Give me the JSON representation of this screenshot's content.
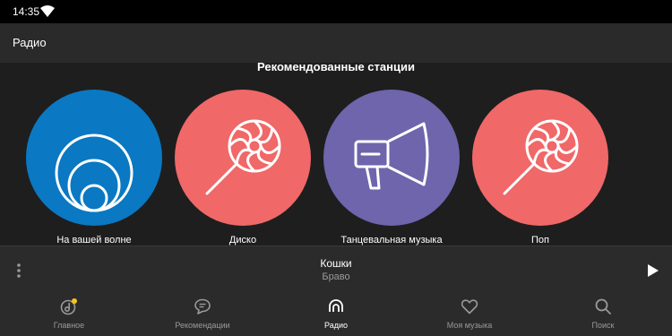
{
  "status_bar": {
    "time": "14:35"
  },
  "app_bar": {
    "title": "Радио"
  },
  "recommended": {
    "title": "Рекомендованные станции",
    "stations": [
      {
        "label": "На вашей волне",
        "color": "#0a78c2",
        "icon": "wave-circles-icon"
      },
      {
        "label": "Диско",
        "color": "#f06868",
        "icon": "lollipop-icon"
      },
      {
        "label": "Танцевальная музыка",
        "color": "#6e65ac",
        "icon": "megaphone-icon"
      },
      {
        "label": "Поп",
        "color": "#f06868",
        "icon": "lollipop-icon"
      }
    ]
  },
  "player": {
    "title": "Кошки",
    "artist": "Браво"
  },
  "nav": {
    "items": [
      {
        "label": "Главное",
        "icon": "music-note-icon",
        "active": false
      },
      {
        "label": "Рекомендации",
        "icon": "chat-bubble-icon",
        "active": false
      },
      {
        "label": "Радио",
        "icon": "radio-icon",
        "active": true
      },
      {
        "label": "Моя музыка",
        "icon": "heart-icon",
        "active": false
      },
      {
        "label": "Поиск",
        "icon": "search-icon",
        "active": false
      }
    ]
  },
  "colors": {
    "accent": "#f5c518",
    "background": "#1e1e1e",
    "bar": "#2b2b2b"
  }
}
